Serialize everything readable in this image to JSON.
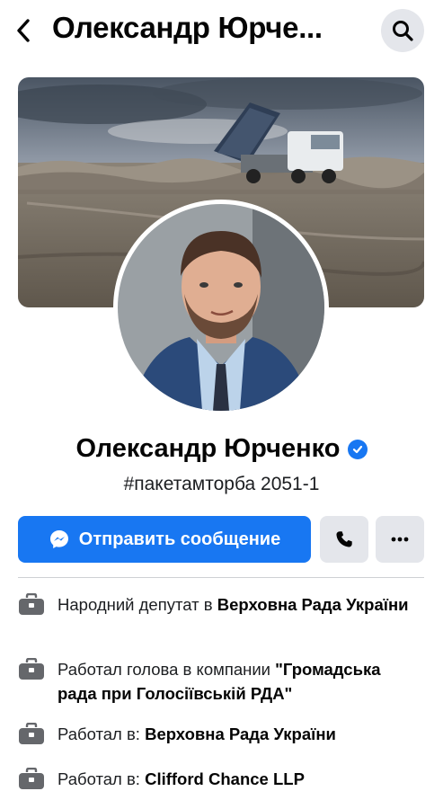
{
  "header": {
    "title": "Олександр Юрче..."
  },
  "profile": {
    "name": "Олександр Юрченко",
    "bio": "#пакетамторба 2051-1"
  },
  "actions": {
    "message_label": "Отправить сообщение"
  },
  "info": [
    {
      "prefix": "Народний депутат в ",
      "bold": "Верховна Рада України",
      "suffix": ""
    },
    {
      "prefix": "Работал голова в компании ",
      "bold": "\"Громадська рада при Голосіївській РДА\"",
      "suffix": ""
    },
    {
      "prefix": "Работал в: ",
      "bold": "Верховна Рада України",
      "suffix": ""
    },
    {
      "prefix": "Работал в: ",
      "bold": "Clifford Chance LLP",
      "suffix": ""
    }
  ],
  "icons": {
    "back": "chevron-left-icon",
    "search": "search-icon",
    "verified": "verified-badge-icon",
    "messenger": "messenger-icon",
    "phone": "phone-icon",
    "more": "more-dots-icon",
    "work": "briefcase-icon"
  },
  "colors": {
    "accent": "#1877f2",
    "button_gray": "#e4e6eb",
    "text": "#050505"
  }
}
